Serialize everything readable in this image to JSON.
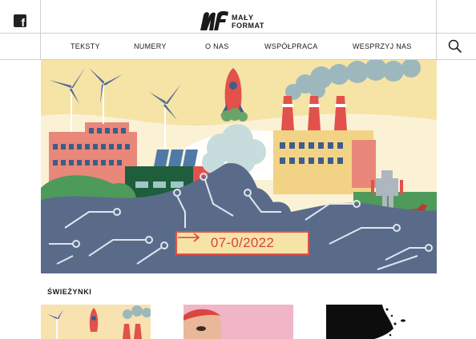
{
  "social": {
    "facebook_icon": "facebook-icon"
  },
  "logo": {
    "line1": "MAŁY",
    "line2": "FORMAT"
  },
  "nav": {
    "items": [
      {
        "label": "TEKSTY"
      },
      {
        "label": "NUMERY"
      },
      {
        "label": "O NAS"
      },
      {
        "label": "WSPÓŁPRACA"
      },
      {
        "label": "WESPRZYJ NAS"
      }
    ],
    "search_icon": "search-icon"
  },
  "hero": {
    "issue_label": "07-0/2022",
    "arrow_icon": "arrow-right-icon",
    "colors": {
      "accent": "#e2514b",
      "sky": "#f6e3a6"
    }
  },
  "section": {
    "title": "ŚWIEŻYNKI"
  }
}
